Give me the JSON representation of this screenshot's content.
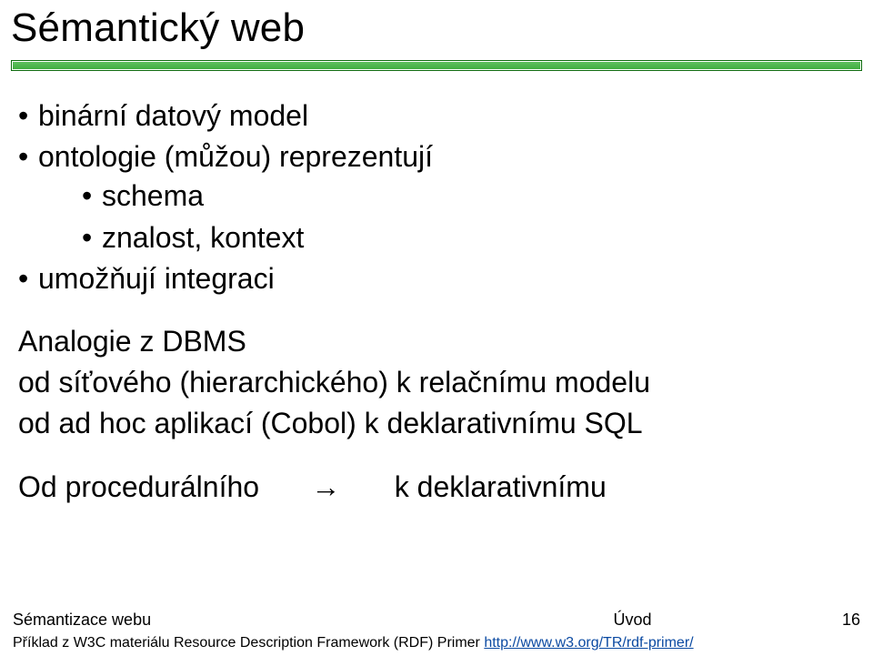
{
  "title": "Sémantický web",
  "bullets_lvl1": [
    {
      "text": "binární datový model"
    },
    {
      "text": "ontologie (můžou) reprezentují",
      "sub": [
        {
          "text": "schema"
        },
        {
          "text": "znalost, kontext"
        }
      ]
    },
    {
      "text": "umožňují integraci"
    }
  ],
  "analogy": {
    "line1": "Analogie z DBMS",
    "line2": "od síťového (hierarchického) k relačnímu modelu",
    "line3": "od ad hoc aplikací (Cobol) k deklarativnímu SQL"
  },
  "arrow_row": {
    "left": "Od procedurálního",
    "arrow": "→",
    "right": "k deklarativnímu"
  },
  "footer": {
    "left": "Sémantizace webu",
    "center": "Úvod",
    "right": "16",
    "note_prefix": "Příklad z W3C materiálu Resource Description Framework (RDF) Primer ",
    "note_link_text": "http://www.w3.org/TR/rdf-primer/",
    "note_link_href": "http://www.w3.org/TR/rdf-primer/"
  }
}
